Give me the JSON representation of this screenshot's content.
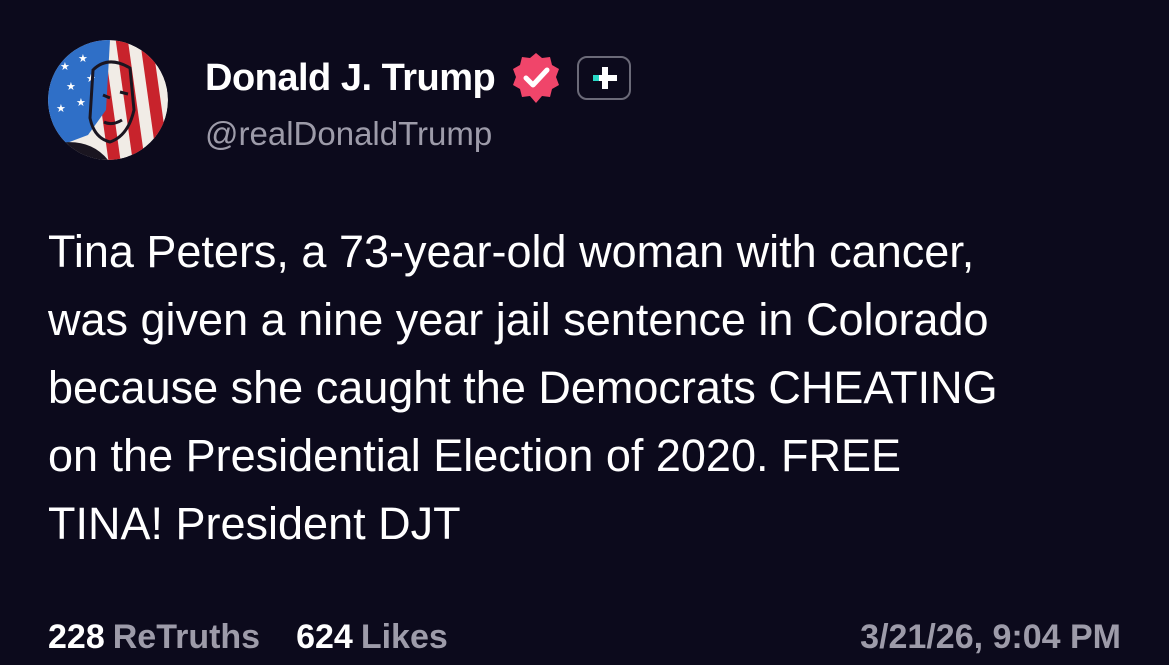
{
  "post": {
    "author": {
      "display_name": "Donald J. Trump",
      "handle": "@realDonaldTrump",
      "avatar_icon": "flag-portrait-avatar",
      "verified_icon": "verified-badge-icon",
      "plus_icon": "plus-badge-icon"
    },
    "body_lines": [
      "Tina Peters, a 73-year-old woman with cancer,",
      "was given a nine year jail sentence in Colorado",
      "because she caught the Democrats CHEATING",
      "on the Presidential Election of 2020. FREE",
      "TINA! President DJT"
    ],
    "stats": {
      "retruths_count": "228",
      "retruths_label": "ReTruths",
      "likes_count": "624",
      "likes_label": "Likes"
    },
    "timestamp": "3/21/26, 9:04 PM"
  },
  "colors": {
    "background": "#0c0a1c",
    "text_primary": "#ffffff",
    "text_secondary": "#9d9ba9",
    "verified_badge": "#f0456a",
    "plus_accent": "#28d9c6"
  }
}
